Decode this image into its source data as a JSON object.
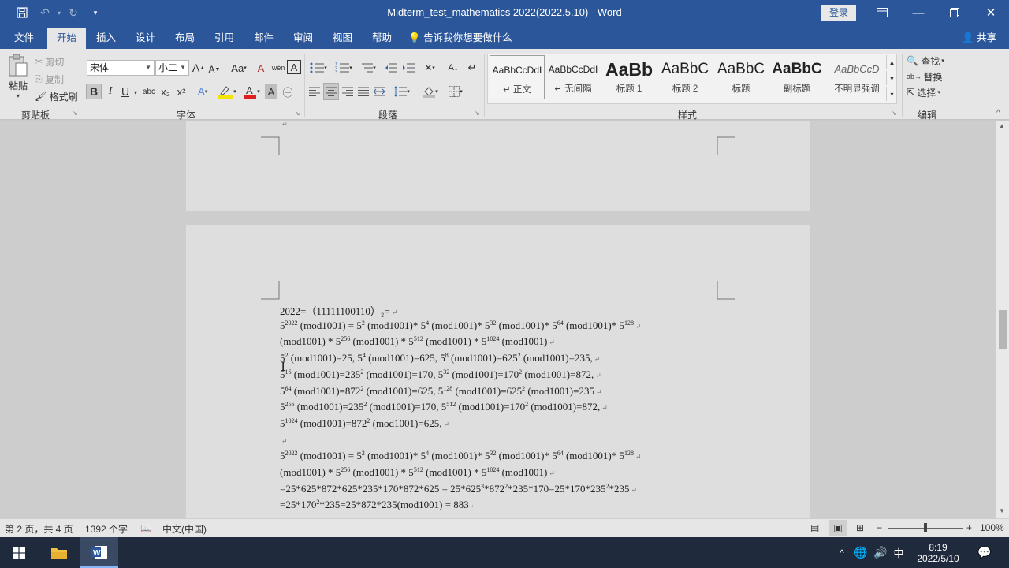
{
  "window": {
    "title": "Midterm_test_mathematics 2022(2022.5.10)  -  Word",
    "login": "登录"
  },
  "tabs": [
    "文件",
    "开始",
    "插入",
    "设计",
    "布局",
    "引用",
    "邮件",
    "审阅",
    "视图",
    "帮助"
  ],
  "tell_me": "告诉我你想要做什么",
  "share": "共享",
  "ribbon": {
    "clipboard": {
      "paste": "粘贴",
      "cut": "剪切",
      "copy": "复制",
      "format_painter": "格式刷",
      "label": "剪贴板"
    },
    "font": {
      "name": "宋体",
      "size": "小二",
      "label": "字体",
      "bold": "B",
      "italic": "I",
      "underline": "U",
      "strike": "abc",
      "sub": "x₂",
      "sup": "x²",
      "grow": "A",
      "shrink": "A",
      "case": "Aa",
      "clear": "A",
      "phonetic": "wén",
      "border": "A"
    },
    "paragraph": {
      "label": "段落"
    },
    "styles": {
      "label": "样式",
      "items": [
        {
          "preview": "AaBbCcDdI",
          "name": "↵ 正文"
        },
        {
          "preview": "AaBbCcDdI",
          "name": "↵ 无间隔"
        },
        {
          "preview": "AaBb",
          "name": "标题 1"
        },
        {
          "preview": "AaBbC",
          "name": "标题 2"
        },
        {
          "preview": "AaBbC",
          "name": "标题"
        },
        {
          "preview": "AaBbC",
          "name": "副标题"
        },
        {
          "preview": "AaBbCcD",
          "name": "不明显强调"
        }
      ]
    },
    "editing": {
      "find": "查找",
      "replace": "替换",
      "select": "选择",
      "label": "编辑"
    }
  },
  "document": {
    "lines": [
      "2022=（11111100110）₂=",
      "5^2022 (mod1001) = 5^2 (mod1001)* 5^4 (mod1001)* 5^32 (mod1001)* 5^64 (mod1001)* 5^128",
      "(mod1001) * 5^256 (mod1001) * 5^512 (mod1001) * 5^1024 (mod1001)",
      "5^2 (mod1001)=25, 5^4 (mod1001)=625,    5^8 (mod1001)=625^2 (mod1001)=235,",
      "5^16 (mod1001)=235^2 (mod1001)=170,    5^32 (mod1001)=170^2 (mod1001)=872,",
      "5^64 (mod1001)=872^2 (mod1001)=625,    5^128 (mod1001)=625^2 (mod1001)=235",
      "5^256 (mod1001)=235^2 (mod1001)=170,    5^512 (mod1001)=170^2 (mod1001)=872,",
      "5^1024 (mod1001)=872^2 (mod1001)=625,",
      "",
      "5^2022 (mod1001) = 5^2 (mod1001)* 5^4 (mod1001)* 5^32 (mod1001)* 5^64 (mod1001)* 5^128",
      "(mod1001) * 5^256 (mod1001) * 5^512 (mod1001) * 5^1024 (mod1001)",
      "=25*625*872*625*235*170*872*625 = 25*625^3*872^2*235*170=25*170*235^2*235",
      "=25*170^2*235=25*872*235(mod1001) = 883"
    ]
  },
  "status": {
    "page": "第 2 页，共 4 页",
    "words": "1392 个字",
    "language": "中文(中国)",
    "zoom": "100%",
    "zoom_fraction": 0.5
  },
  "taskbar": {
    "time": "8:19",
    "date": "2022/5/10",
    "ime": "中"
  }
}
